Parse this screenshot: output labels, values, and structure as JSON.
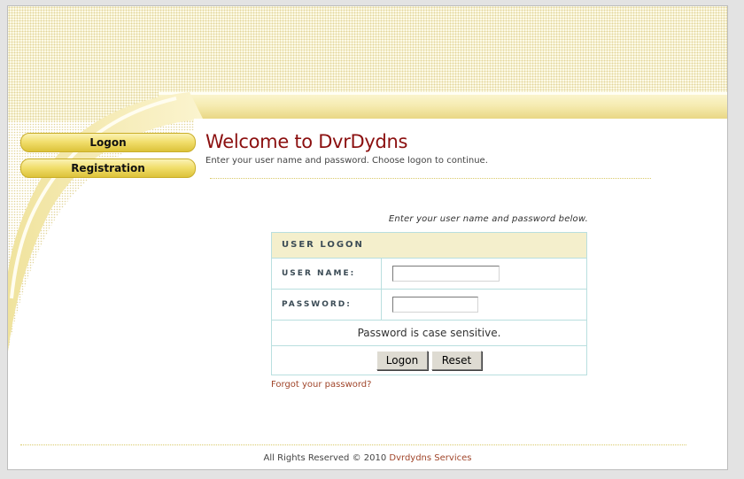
{
  "nav": {
    "logon_label": "Logon",
    "registration_label": "Registration"
  },
  "page": {
    "title": "Welcome to DvrDydns",
    "subtitle": "Enter your user name and password. Choose logon to continue."
  },
  "login": {
    "hint": "Enter your user name and password below.",
    "header": "USER LOGON",
    "username_label": "USER NAME:",
    "username_value": "",
    "password_label": "PASSWORD:",
    "password_value": "",
    "note": "Password is case sensitive.",
    "submit_label": "Logon",
    "reset_label": "Reset",
    "forgot_label": "Forgot your password?"
  },
  "footer": {
    "text": "All Rights Reserved © 2010",
    "link_label": "Dvrdydns Services"
  },
  "colors": {
    "accent_gold": "#dcc23a",
    "title_red": "#8b0f0f",
    "link_brown": "#a0452a",
    "table_border": "#b9dfdf",
    "header_fill": "#f4efcc"
  }
}
